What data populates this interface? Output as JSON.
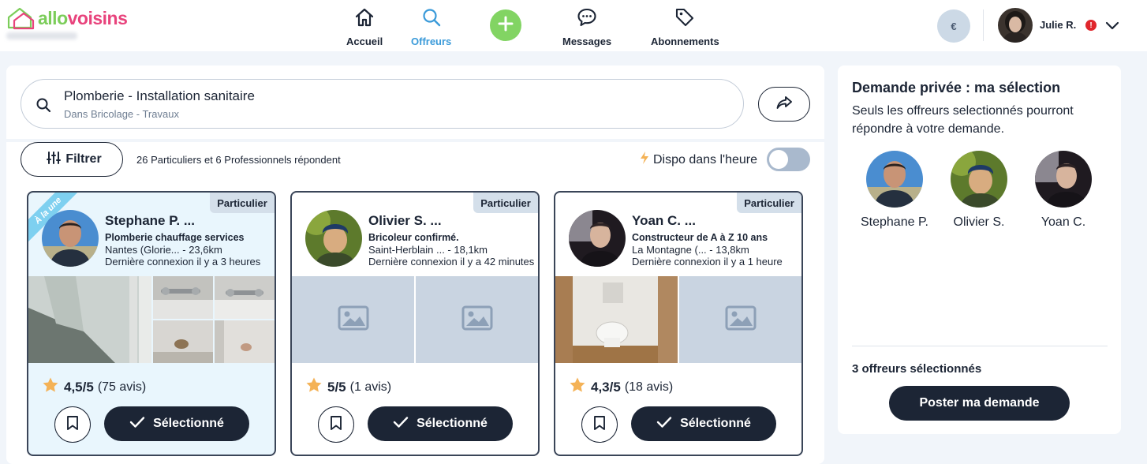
{
  "brand": {
    "logo_part1": "allo",
    "logo_part2": "voisins"
  },
  "nav": {
    "items": [
      {
        "label": "Accueil",
        "icon": "home-icon"
      },
      {
        "label": "Offreurs",
        "icon": "search-icon",
        "active": true
      },
      {
        "label": "Messages",
        "icon": "chat-icon"
      },
      {
        "label": "Abonnements",
        "icon": "tag-icon"
      }
    ],
    "add_icon": "plus-icon"
  },
  "account": {
    "currency": "€",
    "user_name": "Julie R.",
    "alert": "!"
  },
  "search": {
    "title": "Plomberie - Installation sanitaire",
    "subtitle": "Dans Bricolage - Travaux"
  },
  "toolbar": {
    "filter_label": "Filtrer",
    "responders": "26 Particuliers et 6 Professionnels répondent",
    "dispo_label": "Dispo dans l'heure",
    "dispo_on": false
  },
  "cards": [
    {
      "tag": "Particulier",
      "ribbon": "À la une",
      "name": "Stephane P. ...",
      "title": "Plomberie chauffage services",
      "location": "Nantes (Glorie...   - 23,6km",
      "last_seen": "Dernière connexion il y a 3 heures",
      "rating": "4,5/5",
      "reviews": "(75 avis)",
      "select_label": "Sélectionné"
    },
    {
      "tag": "Particulier",
      "name": "Olivier S. ...",
      "title": "Bricoleur confirmé.",
      "location": "Saint-Herblain ...  - 18,1km",
      "last_seen": "Dernière connexion il y a 42 minutes",
      "rating": "5/5",
      "reviews": "(1 avis)",
      "select_label": "Sélectionné"
    },
    {
      "tag": "Particulier",
      "name": "Yoan C. ...",
      "title": "Constructeur de A à Z 10 ans",
      "location": "La Montagne (...   - 13,8km",
      "last_seen": "Dernière connexion il y a 1 heure",
      "rating": "4,3/5",
      "reviews": "(18 avis)",
      "select_label": "Sélectionné"
    }
  ],
  "selection": {
    "title": "Demande privée : ma sélection",
    "description": "Seuls les offreurs selectionnés pourront répondre à votre demande.",
    "people": [
      "Stephane P.",
      "Olivier S.",
      "Yoan C."
    ],
    "count_label": "3 offreurs sélectionnés",
    "post_label": "Poster ma demande"
  },
  "colors": {
    "navy": "#1c2535",
    "accent_blue": "#3a9ad9",
    "green": "#82d463",
    "pink": "#e8437c",
    "alert_red": "#e0262c",
    "featured_bg": "#e9f6fd",
    "star": "#f4b256"
  }
}
